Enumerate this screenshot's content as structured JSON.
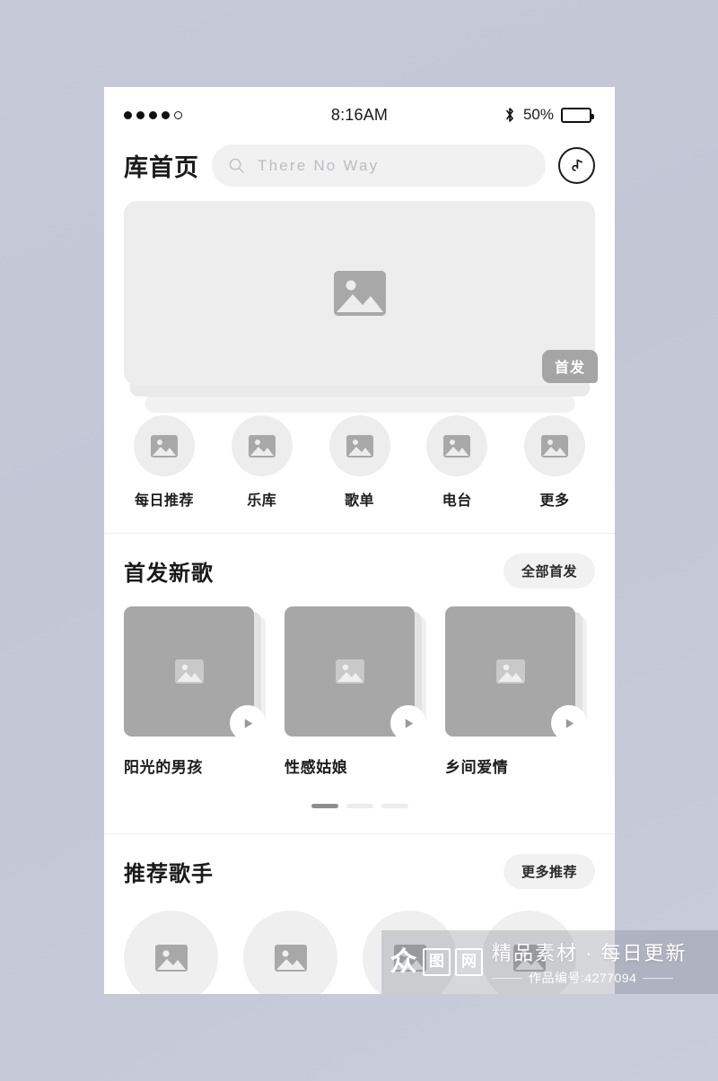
{
  "statusbar": {
    "signal_dots": [
      true,
      true,
      true,
      true,
      false
    ],
    "time": "8:16AM",
    "bluetooth_icon": "bluetooth-icon",
    "battery_percent": "50%",
    "battery_level": 50
  },
  "header": {
    "title": "库首页",
    "search": {
      "icon": "search-icon",
      "placeholder": "There No Way",
      "value": ""
    },
    "note_button_icon": "music-note-icon"
  },
  "banner": {
    "placeholder_icon": "image-placeholder-icon",
    "badge": "首发",
    "stack_layers": 2
  },
  "categories": [
    {
      "label": "每日推荐",
      "icon": "image-placeholder-icon"
    },
    {
      "label": "乐库",
      "icon": "image-placeholder-icon"
    },
    {
      "label": "歌单",
      "icon": "image-placeholder-icon"
    },
    {
      "label": "电台",
      "icon": "image-placeholder-icon"
    },
    {
      "label": "更多",
      "icon": "image-placeholder-icon"
    }
  ],
  "new_songs": {
    "title": "首发新歌",
    "action_label": "全部首发",
    "items": [
      {
        "name": "阳光的男孩",
        "icon": "image-placeholder-icon",
        "play_icon": "play-icon"
      },
      {
        "name": "性感姑娘",
        "icon": "image-placeholder-icon",
        "play_icon": "play-icon"
      },
      {
        "name": "乡间爱情",
        "icon": "image-placeholder-icon",
        "play_icon": "play-icon"
      }
    ],
    "pager": {
      "count": 3,
      "active_index": 0
    }
  },
  "artists": {
    "title": "推荐歌手",
    "action_label": "更多推荐",
    "items": [
      {
        "icon": "image-placeholder-icon"
      },
      {
        "icon": "image-placeholder-icon"
      },
      {
        "icon": "image-placeholder-icon"
      },
      {
        "icon": "image-placeholder-icon"
      }
    ]
  },
  "watermark": {
    "logo_chars": [
      "众",
      "图",
      "网"
    ],
    "tagline": "精品素材 · 每日更新",
    "work_id": "作品编号:4277094"
  },
  "colors": {
    "page_background": "#c4c8d7",
    "phone_background": "#ffffff",
    "accent_text": "#1c1c1c",
    "placeholder_gray": "#a8a8a8",
    "field_gray": "#f1f1f2",
    "badge_gray": "#a5a5a5"
  }
}
